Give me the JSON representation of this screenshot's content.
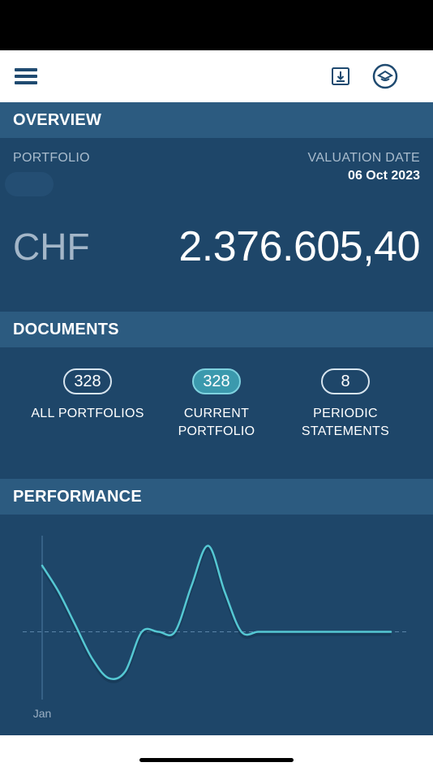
{
  "header": {
    "menu_icon": "hamburger-menu-icon",
    "download_icon": "download-icon",
    "profile_icon": "profile-badge-icon"
  },
  "overview": {
    "title": "OVERVIEW",
    "portfolio_label": "PORTFOLIO",
    "valuation_label": "VALUATION DATE",
    "valuation_date": "06 Oct 2023",
    "currency": "CHF",
    "total_value": "2.376.605,40"
  },
  "documents": {
    "title": "DOCUMENTS",
    "items": [
      {
        "count": "328",
        "label": "ALL PORTFOLIOS",
        "active": false
      },
      {
        "count": "328",
        "label": "CURRENT PORTFOLIO",
        "active": true
      },
      {
        "count": "8",
        "label": "PERIODIC STATEMENTS",
        "active": false
      }
    ]
  },
  "performance": {
    "title": "PERFORMANCE"
  },
  "chart_data": {
    "type": "line",
    "x_tick_labels": [
      "Jan"
    ],
    "series": [
      {
        "values": [
          1.0,
          0.6,
          0.1,
          -0.4,
          -0.7,
          -0.6,
          0.0,
          0.0,
          0.0,
          0.7,
          1.3,
          0.6,
          0.0,
          0.0,
          0.0,
          0.0,
          0.0,
          0.0,
          0.0,
          0.0,
          0.0,
          0.0
        ]
      }
    ],
    "baseline": 0,
    "ylim": [
      -1.0,
      1.6
    ],
    "grid": false,
    "colors": {
      "line": "#55c8d3",
      "baseline": "#5a84a8",
      "axis": "#3f6a8f"
    }
  }
}
